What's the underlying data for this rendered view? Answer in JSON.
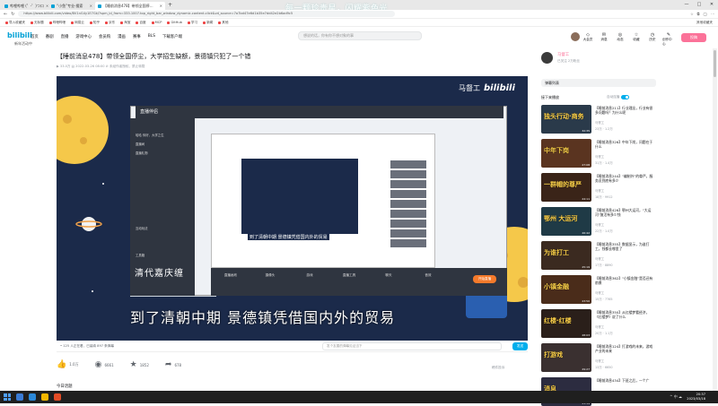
{
  "browser": {
    "tabs": [
      {
        "label": "哔哩哔哩 (゜-゜)つロ",
        "active": false
      },
      {
        "label": "“小鱼”专业·搜索",
        "active": false
      },
      {
        "label": "【睡前消息478】带领全国停…",
        "active": true
      }
    ],
    "overlay_title": "每一颗珍贵星，闪耀紫色光",
    "url": "https://www.bilibili.com/video/BV1nG4y1E7Gk/?spm_id_from=333.1007.top_right_bar_window_dynamic.content.click&vd_source=7a7bd47e6d1b35e7dd42e2b6ad9c5",
    "window_controls": [
      "—",
      "□",
      "✕"
    ],
    "bookmarks": [
      "导入收藏夹",
      "无标题",
      "哔哩哔哩",
      "网易云",
      "知乎",
      "京东",
      "淘宝",
      "百度",
      "MCP",
      "GitHub",
      "学习",
      "新闻",
      "其他"
    ],
    "bookmarks_right": "其他收藏夹"
  },
  "header": {
    "logo": "bilibili",
    "sublogo": "新年活动中",
    "nav": [
      "首页",
      "番剧",
      "直播",
      "游戏中心",
      "会员购",
      "漫画",
      "赛事",
      "BLS",
      "下载客户端"
    ],
    "search_placeholder": "想说的话，你有你不想对象的事",
    "right_nav": [
      {
        "icon": "◇",
        "label": "大会员"
      },
      {
        "icon": "✉",
        "label": "消息"
      },
      {
        "icon": "◎",
        "label": "动态"
      },
      {
        "icon": "☆",
        "label": "收藏"
      },
      {
        "icon": "◷",
        "label": "历史"
      },
      {
        "icon": "✎",
        "label": "创作中心"
      }
    ],
    "upload": "投稿"
  },
  "video": {
    "title": "【睡前消息478】带领全国停尘，大学招生缺额，景德镇只犯了一个错",
    "meta": "▶ 33.0万   ▤ 2022-03-26 08:00   ⊘ 未经作者授权，禁止转载",
    "watermark_name": "马督工",
    "watermark_logo": "bilibili",
    "subtitle": "到了清朝中期 景德镇凭借国内外的贸易",
    "qing_caption": "清代嘉庆缠",
    "inner_app_logo": "直播伴侣",
    "inner_left_rows": [
      "哈哈 你好，大学之生",
      "直播间",
      "直播礼物",
      "互动玩法",
      "工具箱"
    ],
    "inner_subtitle": "到了清朝中期 景德镇凭借国内外的贸易",
    "inner_bottom_tools": [
      "直播画布",
      "摄像头",
      "游戏",
      "直播工具",
      "聊天",
      "音效"
    ],
    "inner_live_button": "开始直播",
    "online": "• 125 人正在看，已装填 897 条弹幕",
    "danmu_placeholder": "发个友善的弹幕见证当下",
    "send": "发送"
  },
  "actions": [
    {
      "icon": "👍",
      "label": "1.0万"
    },
    {
      "icon": "◉",
      "label": "6661"
    },
    {
      "icon": "★",
      "label": "1852"
    },
    {
      "icon": "➦",
      "label": "678"
    }
  ],
  "report": "稿件投诉",
  "hint": "今日话题",
  "uploader": {
    "name": "马督工",
    "desc": "已关注 2万粉丝"
  },
  "danmu_list_label": "弹幕列表",
  "next_title": "接下来播放",
  "autoplay_label": "自动连播",
  "recommendations": [
    {
      "thumb": "独头行动·商务",
      "duration": "32:35",
      "title": "【睡前消息211】行业理念，行业有很多问题吗？为什么呢",
      "author": "马督工",
      "stats": "23万  ·  1.2万"
    },
    {
      "thumb": "中年下岗",
      "duration": "27:08",
      "title": "【睡前消息326】中年下岗，问题在于什么",
      "author": "马督工",
      "stats": "31万  ·  1.4万"
    },
    {
      "thumb": "一群帽的尊严",
      "duration": "24:11",
      "title": "【睡前消息244】“编制外”的尊严，服务员到底有多少",
      "author": "马督工",
      "stats": "18万  ·  9912"
    },
    {
      "thumb": "鄂州 大运河",
      "duration": "26:42",
      "title": "【睡前消息426】鄂州大运河，“大运河”复活有多少钱",
      "author": "马督工",
      "stats": "22万  ·  1.0万"
    },
    {
      "thumb": "为谁打工",
      "duration": "25:19",
      "title": "【睡前消息355】数据显示，为谁打工，钱都去哪里了",
      "author": "马督工",
      "stats": "17万  ·  8890"
    },
    {
      "thumb": "小镇金融",
      "duration": "23:50",
      "title": "【睡前消息362】“小镇金融”是否还有前景",
      "author": "马督工",
      "stats": "15万  ·  7765"
    },
    {
      "thumb": "红楼·红楼",
      "duration": "28:03",
      "title": "【睡前消息350】从红楼梦看经济，《红楼梦》说了什么",
      "author": "马督工",
      "stats": "20万  ·  1.1万"
    },
    {
      "thumb": "打游戏",
      "duration": "29:27",
      "title": "【睡前消息124】打游戏的未来，游戏产业的未来",
      "author": "马督工",
      "stats": "13万  ·  6650"
    },
    {
      "thumb": "消息",
      "duration": "21:14",
      "title": "【睡前消息434】下班之后，一个广",
      "author": "马督工",
      "stats": "—"
    }
  ],
  "taskbar": {
    "time": "20:37",
    "date": "2023/03/18",
    "tray": "^  中  ☁"
  },
  "colors": {
    "accent": "#00a1d6",
    "pink": "#fb7299",
    "player_bg": "#1b2a4a",
    "moon": "#f5c84a"
  }
}
